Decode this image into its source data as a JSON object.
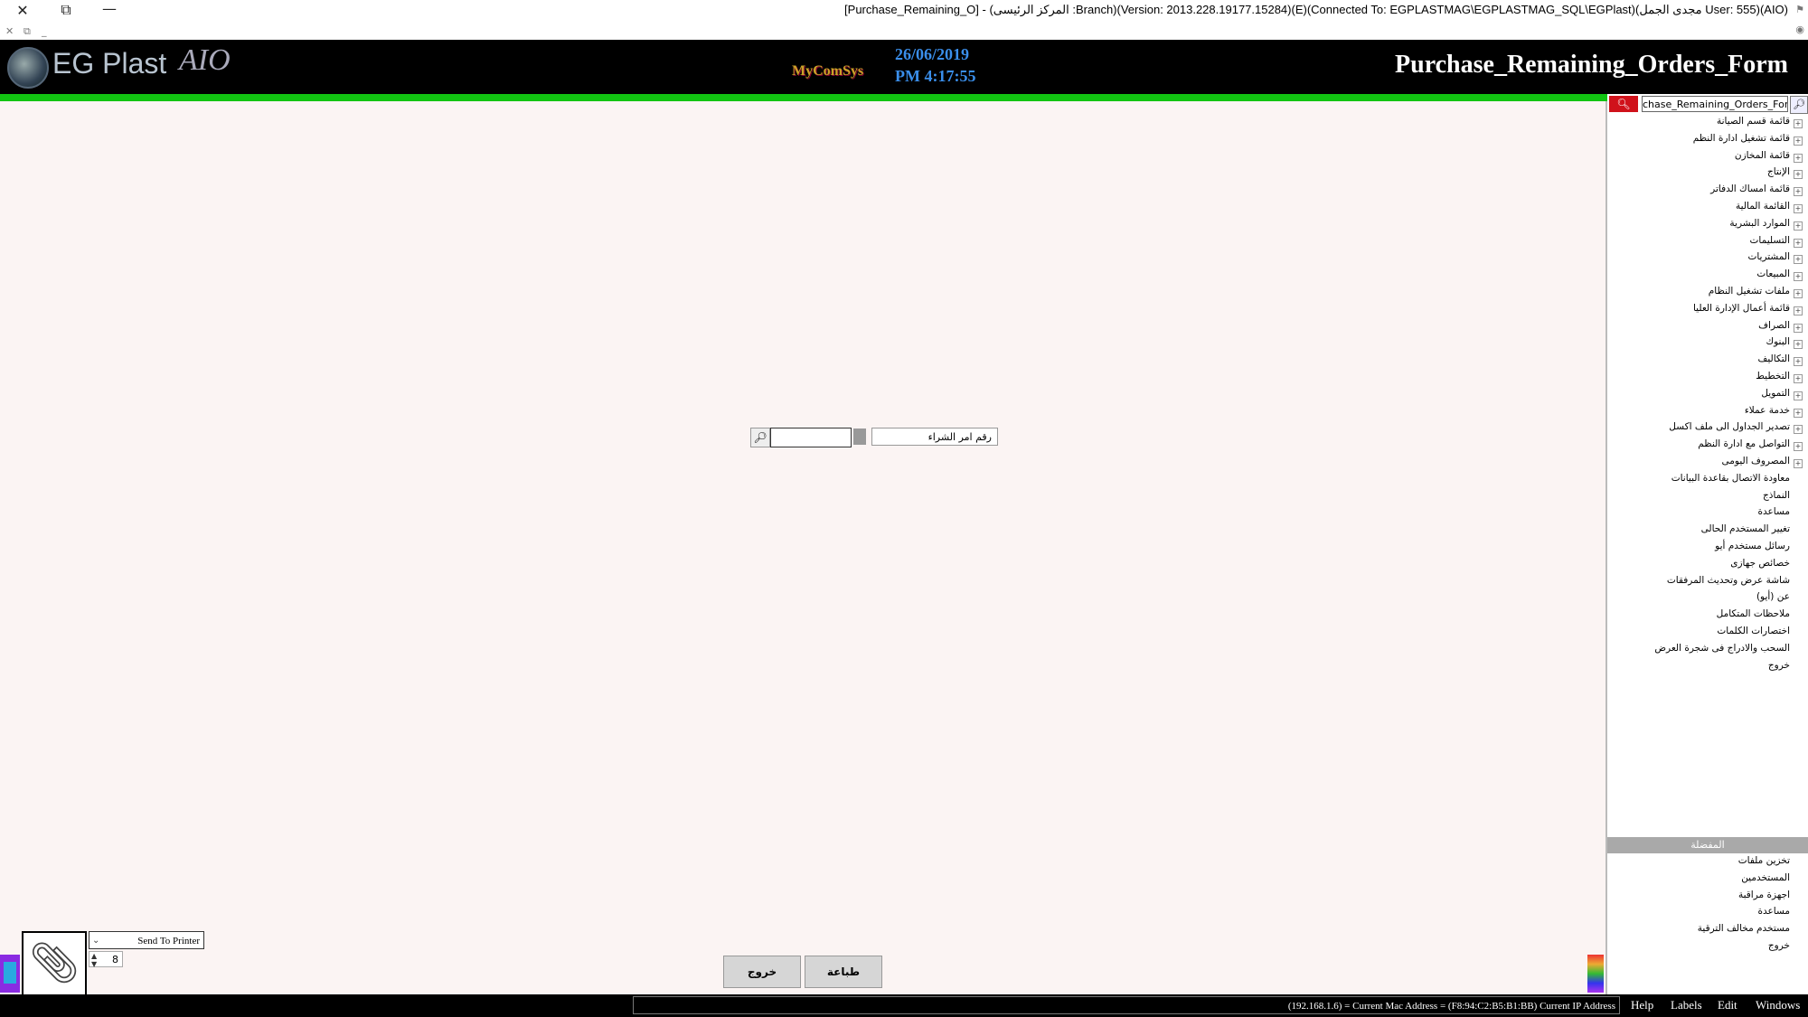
{
  "window": {
    "title": "[Purchase_Remaining_O] - (المركز الرئيسى :Branch)(Version: 2013.228.19177.15284)(E)(Connected To: EGPLASTMAG\\EGPLASTMAG_SQL\\EGPlast)(مجدى الجمل User: 555)(AIO)"
  },
  "header": {
    "logo_text": "EG Plast",
    "logo_aio": "AIO",
    "brand": "MyComSys",
    "date": "26/06/2019",
    "time": "PM 4:17:55",
    "form_title": "Purchase_Remaining_Orders_Form"
  },
  "form": {
    "field_label": "رقم امر الشراء",
    "field_value": ""
  },
  "sidebar": {
    "search_value": "chase_Remaining_Orders_Form",
    "tree": [
      {
        "label": "قائمة قسم الصيانة",
        "expandable": true
      },
      {
        "label": "قائمة تشغيل ادارة النظم",
        "expandable": true
      },
      {
        "label": "قائمة المخازن",
        "expandable": true
      },
      {
        "label": "الإنتاج",
        "expandable": true
      },
      {
        "label": "قائمة امساك الدفاتر",
        "expandable": true
      },
      {
        "label": "القائمة المالية",
        "expandable": true
      },
      {
        "label": "الموارد البشرية",
        "expandable": true
      },
      {
        "label": "التسليمات",
        "expandable": true
      },
      {
        "label": "المشتريات",
        "expandable": true
      },
      {
        "label": "المبيعات",
        "expandable": true
      },
      {
        "label": "ملفات تشغيل النظام",
        "expandable": true
      },
      {
        "label": "قائمة أعمال الإدارة العليا",
        "expandable": true
      },
      {
        "label": "الصراف",
        "expandable": true
      },
      {
        "label": "البنوك",
        "expandable": true
      },
      {
        "label": "التكاليف",
        "expandable": true
      },
      {
        "label": "التخطيط",
        "expandable": true
      },
      {
        "label": "التمويل",
        "expandable": true
      },
      {
        "label": "خدمة عملاء",
        "expandable": true
      },
      {
        "label": "تصدير الجداول الى ملف اكسل",
        "expandable": true
      },
      {
        "label": "التواصل مع ادارة النظم",
        "expandable": true
      },
      {
        "label": "المصروف اليومى",
        "expandable": true
      },
      {
        "label": "معاودة الاتصال بقاعدة البيانات",
        "expandable": false
      },
      {
        "label": "النماذج",
        "expandable": false
      },
      {
        "label": "مساعدة",
        "expandable": false
      },
      {
        "label": "تغيير المستخدم الحالى",
        "expandable": false
      },
      {
        "label": "رسائل مستخدم أيو",
        "expandable": false
      },
      {
        "label": "خصائص جهازى",
        "expandable": false
      },
      {
        "label": "شاشة عرض وتحديث المرفقات",
        "expandable": false
      },
      {
        "label": "عن (أيو)",
        "expandable": false
      },
      {
        "label": "ملاحظات المتكامل",
        "expandable": false
      },
      {
        "label": "اختصارات الكلمات",
        "expandable": false
      },
      {
        "label": "السحب والادراج فى شجرة العرض",
        "expandable": false
      },
      {
        "label": "خروج",
        "expandable": false
      }
    ],
    "favorites_title": "المفضلة",
    "favorites": [
      "تخزين ملفات",
      "المستخدمين",
      "اجهزة مراقبة",
      "مساعدة",
      "مستخدم مخالف الترقية",
      "خروج"
    ]
  },
  "footer": {
    "printer_option": "Send To Printer",
    "copies": "8",
    "exit_button": "خروج",
    "print_button": "طباعة"
  },
  "statusbar": {
    "info": "(192.168.1.6) = Current Mac Address = (F8:94:C2:B5:B1:BB) Current IP Address",
    "menus": [
      "Help",
      "Labels",
      "Edit",
      "Windows"
    ]
  }
}
